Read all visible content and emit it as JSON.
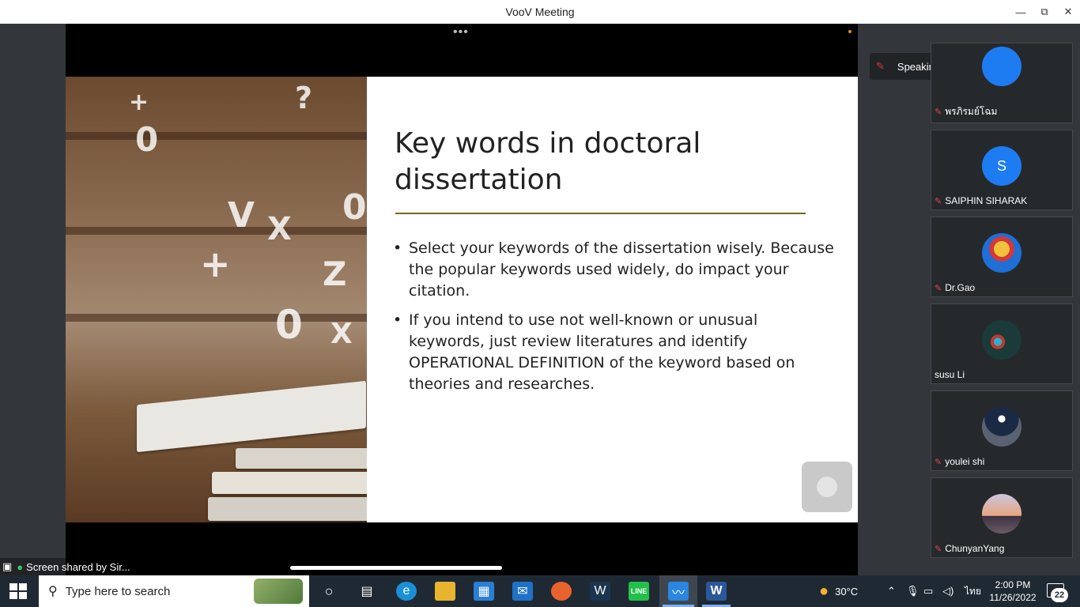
{
  "window": {
    "title": "VooV Meeting",
    "minimize_icon": "—",
    "maximize_icon": "⧉",
    "close_icon": "✕"
  },
  "toolbar": {
    "more_dots": "•••"
  },
  "slide": {
    "title": "Key words in doctoral dissertation",
    "bullets": [
      "Select your keywords of the dissertation wisely. Because the popular keywords used widely, do impact  your citation.",
      "If you intend to use  not well-known or unusual keywords, just review literatures and identify OPERATIONAL DEFINITION of the keyword based on theories and researches."
    ],
    "rule_color": "#7a6326"
  },
  "screen_share": {
    "label": "Screen shared by Sir..."
  },
  "speaking": {
    "label": "Speaking: Sirilak H.;"
  },
  "participants": [
    {
      "name": "พรภิรมย์โฉม",
      "muted": true,
      "avatar_type": "blue-circle",
      "avatar_letter": "",
      "color": "#1e7cf2"
    },
    {
      "name": "SAIPHIN SIHARAK",
      "muted": true,
      "avatar_type": "letter",
      "avatar_letter": "S",
      "color": "#1e7cf2"
    },
    {
      "name": "Dr.Gao",
      "muted": true,
      "avatar_type": "image",
      "avatar_letter": "",
      "color": "#1e6fd6"
    },
    {
      "name": "susu Li",
      "muted": false,
      "avatar_type": "image",
      "avatar_letter": "",
      "color": "#1b3a3a"
    },
    {
      "name": "youlei shi",
      "muted": true,
      "avatar_type": "image",
      "avatar_letter": "",
      "color": "#2c3440"
    },
    {
      "name": "ChunyanYang",
      "muted": true,
      "avatar_type": "image",
      "avatar_letter": "",
      "color": "#c78a6f"
    }
  ],
  "taskbar": {
    "search_placeholder": "Type here to search",
    "weather": "30°C",
    "language": "ไทย",
    "time": "2:00 PM",
    "date": "11/26/2022",
    "notification_count": "22"
  },
  "colors": {
    "accent_blue": "#1e7cf2",
    "muted_red": "#e04848",
    "taskbar": "#1f2933"
  }
}
